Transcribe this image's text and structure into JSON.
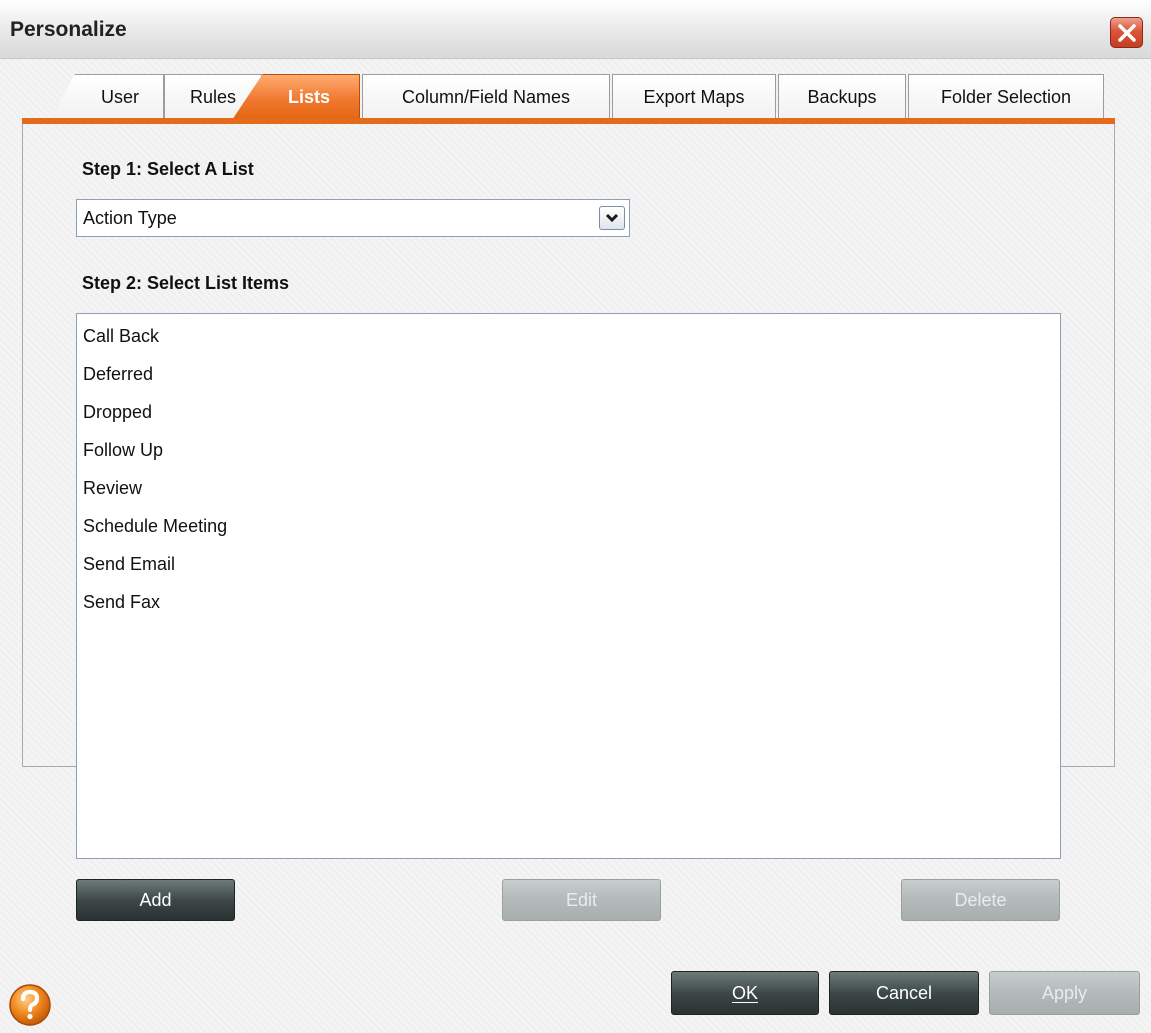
{
  "window": {
    "title": "Personalize",
    "close_icon": "close-icon"
  },
  "tabs": [
    {
      "label": "User",
      "active": false
    },
    {
      "label": "Rules",
      "active": false
    },
    {
      "label": "Lists",
      "active": true
    },
    {
      "label": "Column/Field Names",
      "active": false
    },
    {
      "label": "Export Maps",
      "active": false
    },
    {
      "label": "Backups",
      "active": false
    },
    {
      "label": "Folder Selection",
      "active": false
    }
  ],
  "step1": {
    "label": "Step 1: Select A List",
    "selected_value": "Action Type"
  },
  "step2": {
    "label": "Step 2: Select List Items",
    "items": [
      "Call Back",
      "Deferred",
      "Dropped",
      "Follow Up",
      "Review",
      "Schedule Meeting",
      "Send Email",
      "Send Fax"
    ]
  },
  "list_buttons": {
    "add": "Add",
    "edit": "Edit",
    "delete": "Delete"
  },
  "dialog_buttons": {
    "ok": "OK",
    "cancel": "Cancel",
    "apply": "Apply"
  },
  "help_icon": "help-icon",
  "colors": {
    "accent": "#e46a1c",
    "close_button": "#d9553a",
    "help": "#f08a20",
    "dark_button": "#3e4848"
  }
}
